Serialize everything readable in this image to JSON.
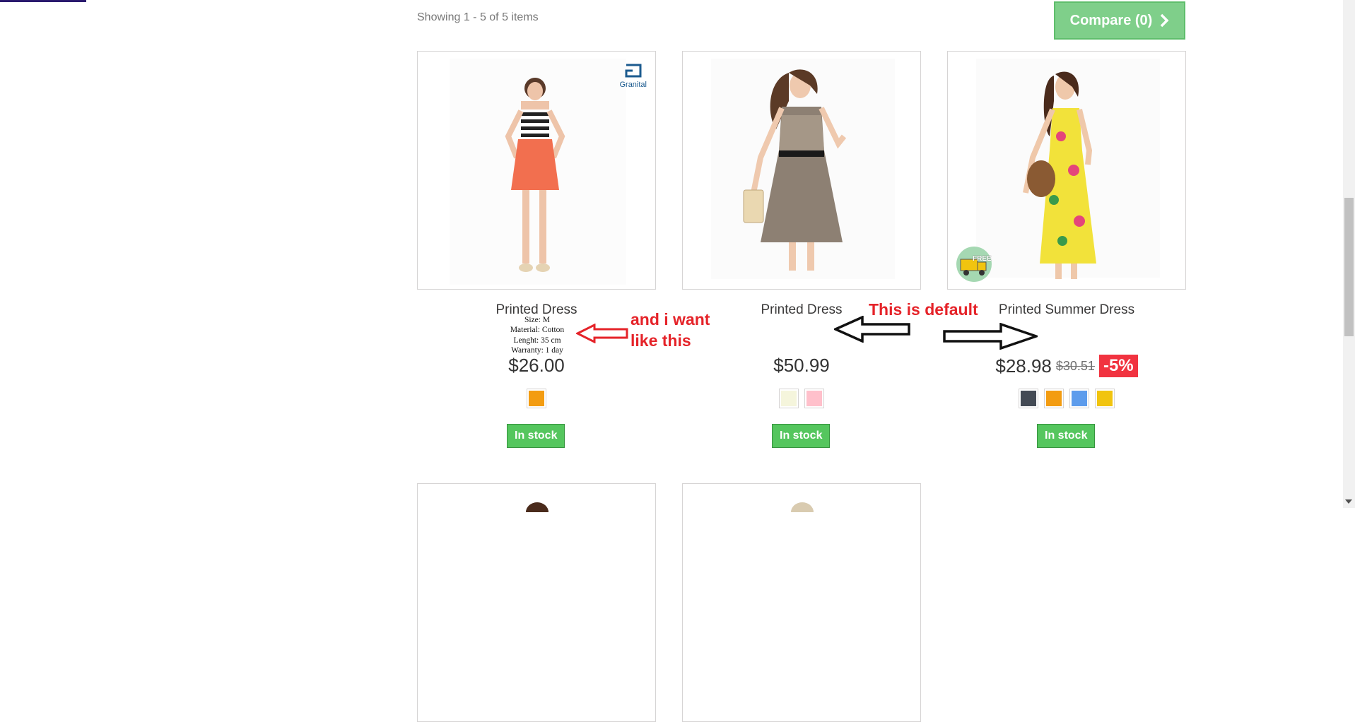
{
  "listing": {
    "showing_text": "Showing 1 - 5 of 5 items",
    "compare_label": "Compare (0)"
  },
  "products": [
    {
      "name": "Printed Dress",
      "price": "$26.00",
      "swatch_colors": [
        "#f39c11"
      ],
      "stock": "In stock",
      "badge": "Granital"
    },
    {
      "name": "Printed Dress",
      "price": "$50.99",
      "swatch_colors": [
        "#f5f5dc",
        "#ffc0cb"
      ],
      "stock": "In stock"
    },
    {
      "name": "Printed Summer Dress",
      "price": "$28.98",
      "old_price": "$30.51",
      "discount": "-5%",
      "swatch_colors": [
        "#434a54",
        "#f39c11",
        "#5d9cec",
        "#f1c40f"
      ],
      "stock": "In stock",
      "badge": "FREE"
    }
  ],
  "specs": {
    "size": "Size: M",
    "material": "Material: Cotton",
    "length": "Lenght: 35 cm",
    "warranty": "Warranty: 1 day"
  },
  "annotations": {
    "want_line1": "and i want",
    "want_line2": "like this",
    "default": "This is default"
  },
  "colors": {
    "compare_bg": "#7fcf8a",
    "stock_bg": "#55c65e",
    "discount_bg": "#f13340",
    "annotation": "#e52329"
  }
}
